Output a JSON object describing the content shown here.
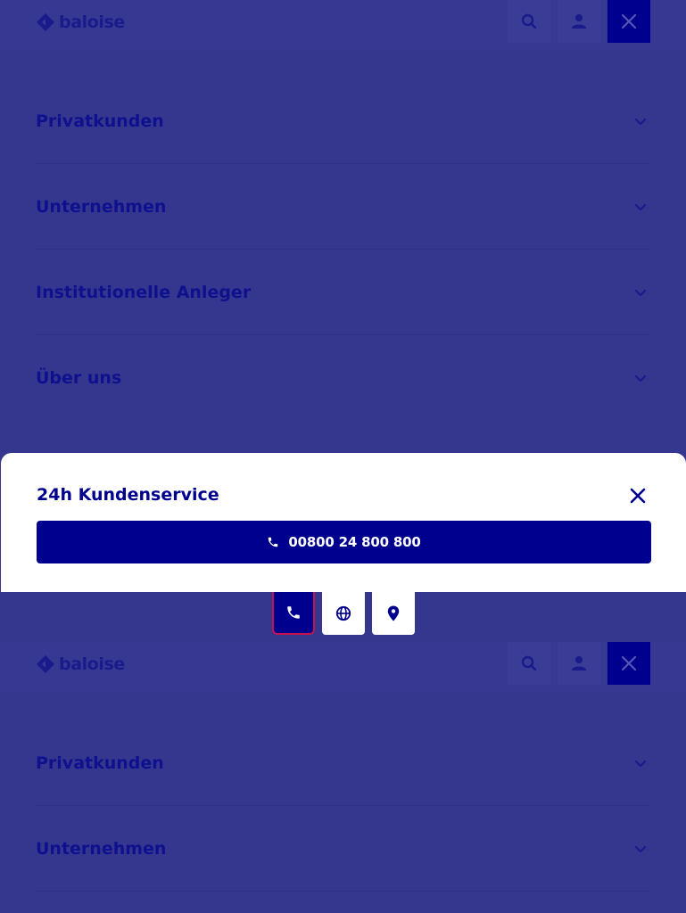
{
  "brand": {
    "name": "baloise",
    "color": "#00008f",
    "accent": "#c4124f"
  },
  "header": {
    "search_icon": "search-icon",
    "user_icon": "user-icon",
    "close_icon": "close-icon"
  },
  "nav": {
    "items": [
      {
        "label": "Privatkunden"
      },
      {
        "label": "Unternehmen"
      },
      {
        "label": "Institutionelle Anleger"
      },
      {
        "label": "Über uns"
      }
    ]
  },
  "service_sheet": {
    "title": "24h Kundenservice",
    "phone_number": "00800 24 800 800",
    "close_icon": "close-icon"
  },
  "tabs": [
    {
      "icon": "phone-icon",
      "active": true
    },
    {
      "icon": "globe-icon",
      "active": false
    },
    {
      "icon": "location-pin-icon",
      "active": false
    }
  ]
}
